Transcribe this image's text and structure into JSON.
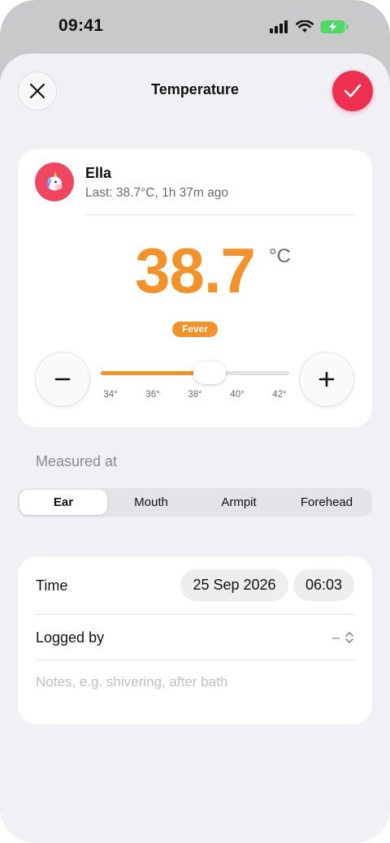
{
  "status_bar": {
    "time": "09:41",
    "icons": [
      "signal-icon",
      "wifi-icon",
      "battery-charging-icon"
    ],
    "battery_color": "#4cd964"
  },
  "header": {
    "title": "Temperature",
    "close_icon": "close-icon",
    "confirm_icon": "checkmark-icon",
    "confirm_color": "#ef2f4f"
  },
  "profile": {
    "name": "Ella",
    "last_reading": "Last: 38.7°C, 1h 37m ago",
    "avatar_icon": "unicorn-icon"
  },
  "reading": {
    "value": "38.7",
    "unit": "°C",
    "status": "Fever",
    "accent_color": "#f39228"
  },
  "slider": {
    "min": 34,
    "max": 42,
    "current": 38.7,
    "ticks": [
      "34°",
      "36°",
      "38°",
      "40°",
      "42°"
    ]
  },
  "measured_at": {
    "label": "Measured at",
    "options": [
      "Ear",
      "Mouth",
      "Armpit",
      "Forehead"
    ],
    "selected": "Ear"
  },
  "details": {
    "time_label": "Time",
    "date": "25 Sep 2026",
    "time": "06:03",
    "logged_by_label": "Logged by",
    "logged_by_value": "–",
    "notes_placeholder": "Notes, e.g. shivering, after bath"
  }
}
